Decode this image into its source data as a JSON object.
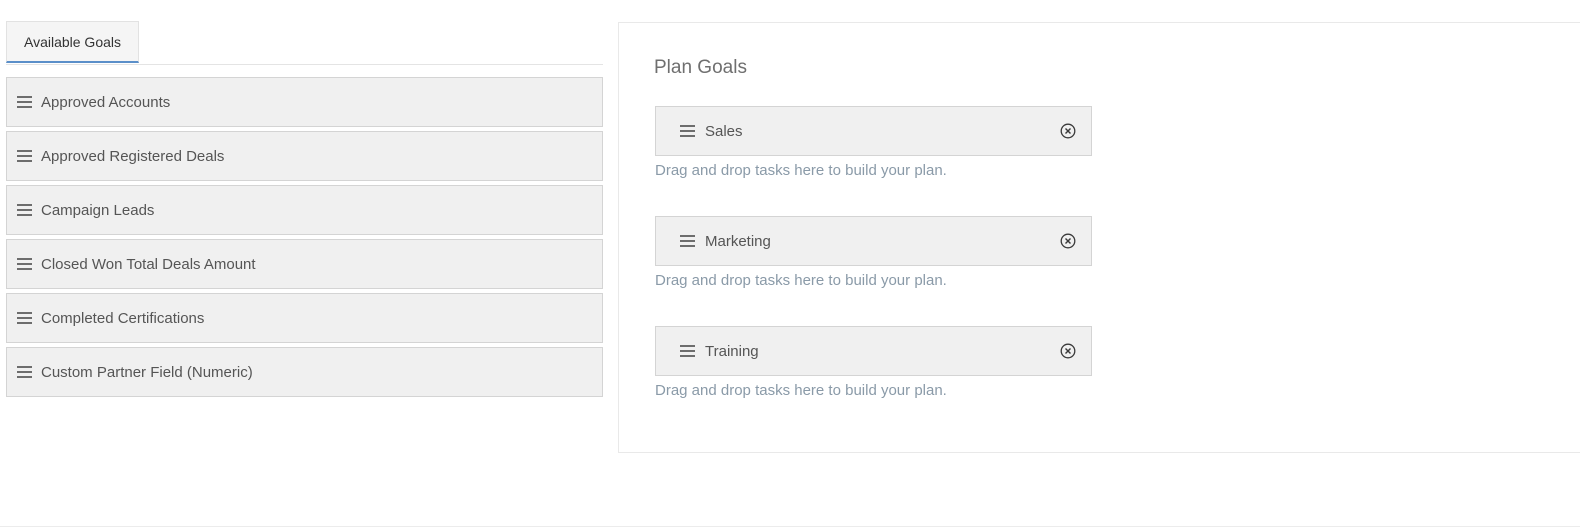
{
  "tabs": [
    {
      "label": "Available Goals",
      "active": true
    }
  ],
  "available_goals": [
    {
      "label": "Approved Accounts"
    },
    {
      "label": "Approved Registered Deals"
    },
    {
      "label": "Campaign Leads"
    },
    {
      "label": "Closed Won Total Deals Amount"
    },
    {
      "label": "Completed Certifications"
    },
    {
      "label": "Custom Partner Field (Numeric)"
    }
  ],
  "plan": {
    "title": "Plan Goals",
    "groups": [
      {
        "label": "Sales",
        "hint": "Drag and drop tasks here to build your plan."
      },
      {
        "label": "Marketing",
        "hint": "Drag and drop tasks here to build your plan."
      },
      {
        "label": "Training",
        "hint": "Drag and drop tasks here to build your plan."
      }
    ]
  },
  "icons": {
    "drag_handle": "hamburger-icon",
    "remove": "close-circle-icon"
  },
  "colors": {
    "tab_accent": "#5b8fc9",
    "item_background": "#f0f0f0",
    "hint_text": "#8a9aa8"
  }
}
